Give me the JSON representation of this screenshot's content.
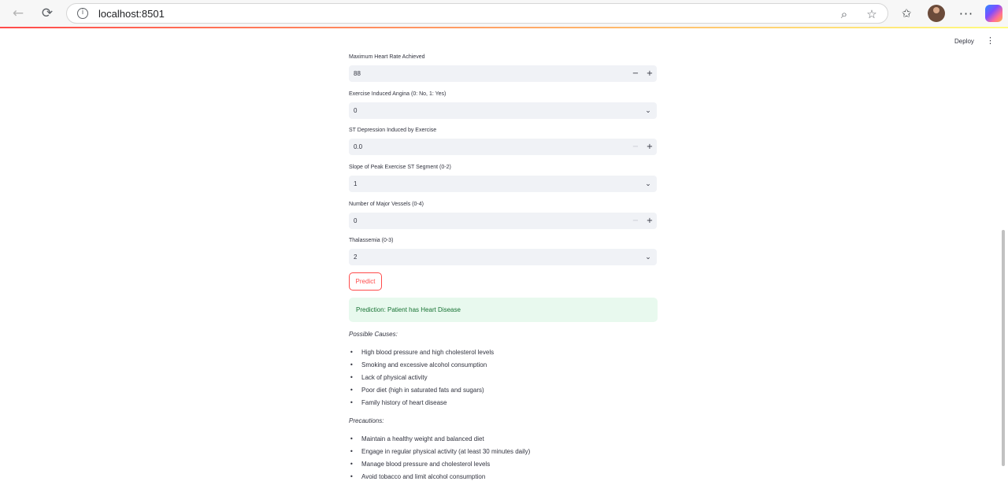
{
  "browser": {
    "url": "localhost:8501"
  },
  "header": {
    "deploy_label": "Deploy"
  },
  "form": {
    "max_hr": {
      "label": "Maximum Heart Rate Achieved",
      "value": "88"
    },
    "exang": {
      "label": "Exercise Induced Angina (0: No, 1: Yes)",
      "value": "0"
    },
    "oldpeak": {
      "label": "ST Depression Induced by Exercise",
      "value": "0.0"
    },
    "slope": {
      "label": "Slope of Peak Exercise ST Segment (0-2)",
      "value": "1"
    },
    "ca": {
      "label": "Number of Major Vessels (0-4)",
      "value": "0"
    },
    "thal": {
      "label": "Thalassemia (0-3)",
      "value": "2"
    },
    "predict_label": "Predict"
  },
  "result": {
    "text": "Prediction: Patient has Heart Disease"
  },
  "causes": {
    "title": "Possible Causes:",
    "items": [
      "High blood pressure and high cholesterol levels",
      "Smoking and excessive alcohol consumption",
      "Lack of physical activity",
      "Poor diet (high in saturated fats and sugars)",
      "Family history of heart disease"
    ]
  },
  "precautions": {
    "title": "Precautions:",
    "items": [
      "Maintain a healthy weight and balanced diet",
      "Engage in regular physical activity (at least 30 minutes daily)",
      "Manage blood pressure and cholesterol levels",
      "Avoid tobacco and limit alcohol consumption"
    ]
  },
  "colors": {
    "accent": "#ff4b4b",
    "success_bg": "#e8f9ee",
    "success_text": "#177233"
  }
}
